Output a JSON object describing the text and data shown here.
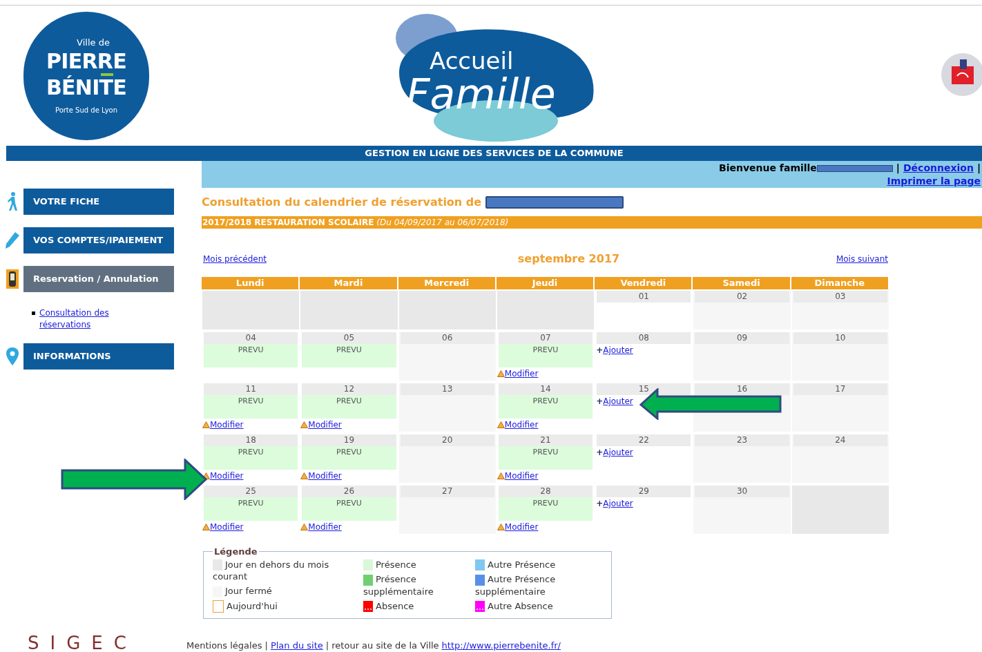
{
  "header": {
    "city_logo": {
      "line_1": "Ville de",
      "line_2": "PIERRE",
      "line_3": "BÉNITE",
      "tagline": "Porte Sud de Lyon"
    },
    "app_logo": {
      "line_1": "Accueil",
      "line_2": "Famille"
    },
    "banner": "GESTION EN LIGNE DES SERVICES DE LA COMMUNE"
  },
  "user_bar": {
    "welcome": "Bienvenue famille",
    "separator_1": "|",
    "logout": "Déconnexion",
    "separator_2": "|",
    "print": "Imprimer la page"
  },
  "sidebar": {
    "items": [
      {
        "label": "VOTRE FICHE",
        "selected": false
      },
      {
        "label": "VOS COMPTES/IPAIEMENT",
        "selected": false
      },
      {
        "label": "Reservation / Annulation",
        "selected": true,
        "children": [
          {
            "label": "Consultation des réservations"
          }
        ]
      },
      {
        "label": "INFORMATIONS",
        "selected": false
      }
    ]
  },
  "page": {
    "title": "Consultation du calendrier de réservation de",
    "service": {
      "name": "2017/2018 RESTAURATION SCOLAIRE",
      "period": "(Du 04/09/2017 au 06/07/2018)"
    }
  },
  "calendar": {
    "prev": "Mois précédent",
    "month": "septembre 2017",
    "next": "Mois suivant",
    "columns": [
      "Lundi",
      "Mardi",
      "Mercredi",
      "Jeudi",
      "Vendredi",
      "Samedi",
      "Dimanche"
    ],
    "weeks": [
      [
        {
          "kind": "outside"
        },
        {
          "kind": "outside"
        },
        {
          "kind": "outside"
        },
        {
          "kind": "outside"
        },
        {
          "kind": "open",
          "day": "01"
        },
        {
          "kind": "closed",
          "day": "02"
        },
        {
          "kind": "closed",
          "day": "03"
        }
      ],
      [
        {
          "kind": "open",
          "day": "04",
          "status": "PREVU"
        },
        {
          "kind": "open",
          "day": "05",
          "status": "PREVU"
        },
        {
          "kind": "closed",
          "day": "06"
        },
        {
          "kind": "open",
          "day": "07",
          "status": "PREVU",
          "action": {
            "kind": "modify",
            "label": "Modifier"
          }
        },
        {
          "kind": "open",
          "day": "08",
          "action": {
            "kind": "add",
            "symbol": "+",
            "label": "Ajouter"
          }
        },
        {
          "kind": "closed",
          "day": "09"
        },
        {
          "kind": "closed",
          "day": "10"
        }
      ],
      [
        {
          "kind": "open",
          "day": "11",
          "status": "PREVU",
          "action": {
            "kind": "modify",
            "label": "Modifier"
          }
        },
        {
          "kind": "open",
          "day": "12",
          "status": "PREVU",
          "action": {
            "kind": "modify",
            "label": "Modifier"
          }
        },
        {
          "kind": "closed",
          "day": "13"
        },
        {
          "kind": "open",
          "day": "14",
          "status": "PREVU",
          "action": {
            "kind": "modify",
            "label": "Modifier"
          }
        },
        {
          "kind": "open",
          "day": "15",
          "action": {
            "kind": "add",
            "symbol": "+",
            "label": "Ajouter"
          }
        },
        {
          "kind": "closed",
          "day": "16"
        },
        {
          "kind": "closed",
          "day": "17"
        }
      ],
      [
        {
          "kind": "open",
          "day": "18",
          "status": "PREVU",
          "action": {
            "kind": "modify",
            "label": "Modifier"
          }
        },
        {
          "kind": "open",
          "day": "19",
          "status": "PREVU",
          "action": {
            "kind": "modify",
            "label": "Modifier"
          }
        },
        {
          "kind": "closed",
          "day": "20"
        },
        {
          "kind": "open",
          "day": "21",
          "status": "PREVU",
          "action": {
            "kind": "modify",
            "label": "Modifier"
          }
        },
        {
          "kind": "open",
          "day": "22",
          "action": {
            "kind": "add",
            "symbol": "+",
            "label": "Ajouter"
          }
        },
        {
          "kind": "closed",
          "day": "23"
        },
        {
          "kind": "closed",
          "day": "24"
        }
      ],
      [
        {
          "kind": "open",
          "day": "25",
          "status": "PREVU",
          "action": {
            "kind": "modify",
            "label": "Modifier"
          }
        },
        {
          "kind": "open",
          "day": "26",
          "status": "PREVU",
          "action": {
            "kind": "modify",
            "label": "Modifier"
          }
        },
        {
          "kind": "closed",
          "day": "27"
        },
        {
          "kind": "open",
          "day": "28",
          "status": "PREVU",
          "action": {
            "kind": "modify",
            "label": "Modifier"
          }
        },
        {
          "kind": "open",
          "day": "29",
          "action": {
            "kind": "add",
            "symbol": "+",
            "label": "Ajouter"
          }
        },
        {
          "kind": "closed",
          "day": "30"
        },
        {
          "kind": "outside"
        }
      ]
    ]
  },
  "legend": {
    "title": "Légende",
    "items": [
      {
        "label": "Jour en dehors du mois courant",
        "kind": "fill",
        "color": "#e8e8e8"
      },
      {
        "label": "Jour fermé",
        "kind": "fill",
        "color": "#f6f6f6"
      },
      {
        "label": "Aujourd'hui",
        "kind": "outline",
        "color": "#e8a040"
      },
      {
        "label": "Présence",
        "kind": "fill",
        "color": "#d8f8d8"
      },
      {
        "label": "Présence supplémentaire",
        "kind": "fill",
        "color": "#70d070"
      },
      {
        "label": "Absence",
        "kind": "dots",
        "color": "#ff0000"
      },
      {
        "label": "Autre Présence",
        "kind": "fill",
        "color": "#80c8f0"
      },
      {
        "label": "Autre Présence supplémentaire",
        "kind": "fill",
        "color": "#5890e8"
      },
      {
        "label": "Autre Absence",
        "kind": "dots",
        "color": "#ff00ff"
      }
    ]
  },
  "footer": {
    "brand": "SIGEC",
    "legal": "Mentions légales",
    "separator": "|",
    "sitemap": "Plan du site",
    "back_text": "| retour au site de la Ville",
    "url": "http://www.pierrebenite.fr/"
  }
}
